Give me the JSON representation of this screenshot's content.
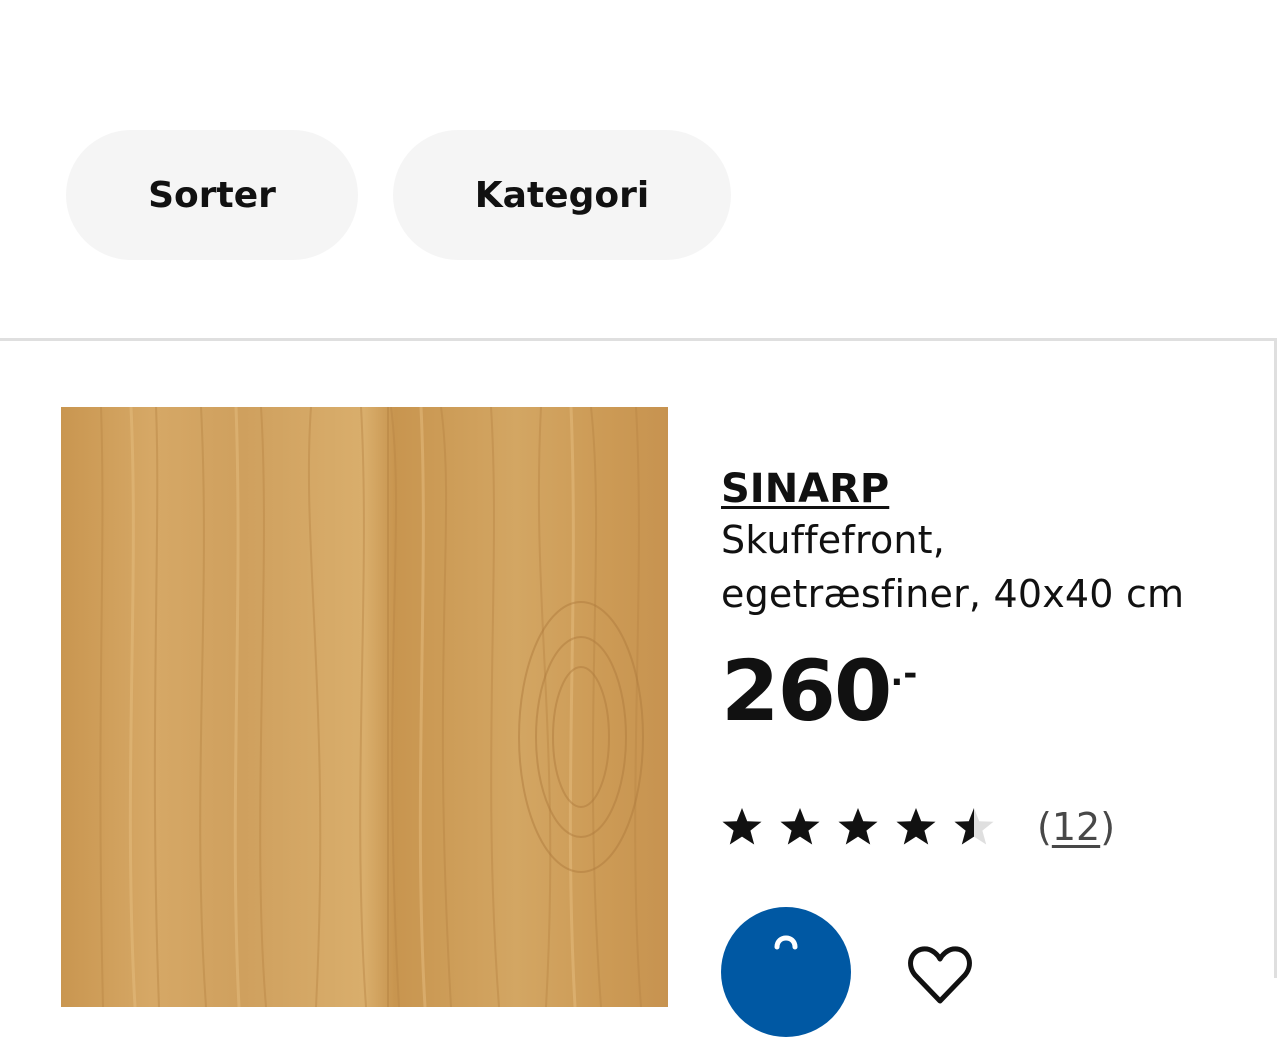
{
  "filters": {
    "sort_label": "Sorter",
    "category_label": "Kategori"
  },
  "product": {
    "name": "SINARP",
    "description_line1": "Skuffefront,",
    "description_line2": "egetræsfiner, 40x40 cm",
    "price": "260",
    "price_suffix": ".-",
    "rating_value": 4.5,
    "rating_max": 5,
    "review_count_open": "(",
    "review_count": "12",
    "review_count_close": ")",
    "image_icon": "oak-veneer-panel",
    "cart_icon": "cart-icon",
    "favourite_icon": "heart-icon"
  },
  "colors": {
    "pill_background": "#f5f5f5",
    "accent_blue": "#0058a3",
    "text": "#111111",
    "card_border": "#dfdfdf",
    "wood": "#cf9f5c"
  }
}
